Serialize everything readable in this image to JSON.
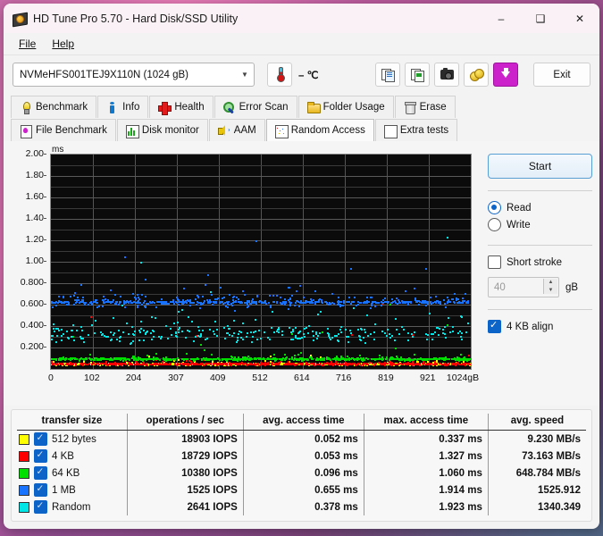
{
  "window": {
    "title": "HD Tune Pro 5.70 - Hard Disk/SSD Utility",
    "app_icon": "hard-disk-icon",
    "minimize": "–",
    "maximize": "❑",
    "close": "✕"
  },
  "menubar": {
    "items": [
      {
        "label": "File"
      },
      {
        "label": "Help"
      }
    ]
  },
  "toolbar": {
    "drive": "NVMeHFS001TEJ9X110N (1024 gB)",
    "dropdown_icon": "chevron-down-icon",
    "temperature": "– ℃",
    "thermometer_icon": "thermometer-icon",
    "buttons": [
      {
        "name": "copy-text-button",
        "icon": "copy-document-icon"
      },
      {
        "name": "copy-image-button",
        "icon": "copy-image-icon"
      },
      {
        "name": "screenshot-button",
        "icon": "camera-icon"
      },
      {
        "name": "donate-button",
        "icon": "coins-icon"
      },
      {
        "name": "download-button",
        "icon": "download-arrow-icon"
      }
    ],
    "exit": "Exit"
  },
  "tabs": {
    "row1": [
      {
        "label": "Benchmark",
        "icon": "lightbulb-icon",
        "active": false
      },
      {
        "label": "Info",
        "icon": "info-icon",
        "active": false
      },
      {
        "label": "Health",
        "icon": "red-cross-icon",
        "active": false
      },
      {
        "label": "Error Scan",
        "icon": "magnifier-icon",
        "active": false
      },
      {
        "label": "Folder Usage",
        "icon": "folder-icon",
        "active": false
      },
      {
        "label": "Erase",
        "icon": "trash-icon",
        "active": false
      }
    ],
    "row2": [
      {
        "label": "File Benchmark",
        "icon": "file-benchmark-icon",
        "active": false
      },
      {
        "label": "Disk monitor",
        "icon": "bar-chart-icon",
        "active": false
      },
      {
        "label": "AAM",
        "icon": "speaker-icon",
        "active": false
      },
      {
        "label": "Random Access",
        "icon": "scatter-plot-icon",
        "active": true
      },
      {
        "label": "Extra tests",
        "icon": "extra-tests-icon",
        "active": false
      }
    ]
  },
  "panel": {
    "start_button": "Start",
    "mode_read": "Read",
    "mode_write": "Write",
    "mode_selected": "Read",
    "short_stroke_label": "Short stroke",
    "short_stroke_checked": false,
    "short_stroke_value": "40",
    "short_stroke_unit": "gB",
    "align_label": "4 KB align",
    "align_checked": true,
    "spinner_up_icon": "spinner-up-icon",
    "spinner_down_icon": "spinner-down-icon"
  },
  "chart_data": {
    "type": "scatter",
    "title": "",
    "xlabel": "",
    "ylabel": "ms",
    "yunit": "ms",
    "xunit": "gB",
    "xlim": [
      0,
      1024
    ],
    "ylim": [
      0,
      2.0
    ],
    "grid": true,
    "background": "#0b0b0b",
    "xticks": [
      0,
      102,
      204,
      307,
      409,
      512,
      614,
      716,
      819,
      921,
      1024
    ],
    "xticklabels": [
      "0",
      "102",
      "204",
      "307",
      "409",
      "512",
      "614",
      "716",
      "819",
      "921",
      "1024gB"
    ],
    "yticks": [
      0.2,
      0.4,
      0.6,
      0.8,
      1.0,
      1.2,
      1.4,
      1.6,
      1.8,
      2.0
    ],
    "yticklabels": [
      "0.200",
      "0.400",
      "0.600",
      "0.800",
      "1.00",
      "1.20",
      "1.40",
      "1.60",
      "1.80",
      "2.00"
    ],
    "legend_position": "bottom-table",
    "series": [
      {
        "name": "512 bytes",
        "color": "#ffff00",
        "mean_ms": 0.052,
        "max_ms": 0.337,
        "band_center": 0.052,
        "band_spread": 0.03,
        "density": 260
      },
      {
        "name": "4 KB",
        "color": "#ff0000",
        "mean_ms": 0.053,
        "max_ms": 1.327,
        "band_center": 0.053,
        "band_spread": 0.032,
        "density": 300
      },
      {
        "name": "64 KB",
        "color": "#00e000",
        "mean_ms": 0.096,
        "max_ms": 1.06,
        "band_center": 0.1,
        "band_spread": 0.05,
        "density": 280
      },
      {
        "name": "1 MB",
        "color": "#1874ff",
        "mean_ms": 0.655,
        "max_ms": 1.914,
        "band_center": 0.63,
        "band_spread": 0.17,
        "density": 300
      },
      {
        "name": "Random",
        "color": "#00e5e5",
        "mean_ms": 0.378,
        "max_ms": 1.923,
        "band_center": 0.33,
        "band_spread": 0.23,
        "density": 290
      }
    ]
  },
  "results": {
    "columns": [
      "transfer size",
      "operations / sec",
      "avg. access time",
      "max. access time",
      "avg. speed"
    ],
    "rows": [
      {
        "color": "#ffff00",
        "checked": true,
        "size": "512 bytes",
        "ops": "18903 IOPS",
        "avg_access": "0.052 ms",
        "max_access": "0.337 ms",
        "avg_speed": "9.230 MB/s"
      },
      {
        "color": "#ff0000",
        "checked": true,
        "size": "4 KB",
        "ops": "18729 IOPS",
        "avg_access": "0.053 ms",
        "max_access": "1.327 ms",
        "avg_speed": "73.163 MB/s"
      },
      {
        "color": "#00e000",
        "checked": true,
        "size": "64 KB",
        "ops": "10380 IOPS",
        "avg_access": "0.096 ms",
        "max_access": "1.060 ms",
        "avg_speed": "648.784 MB/s"
      },
      {
        "color": "#1874ff",
        "checked": true,
        "size": "1 MB",
        "ops": "1525 IOPS",
        "avg_access": "0.655 ms",
        "max_access": "1.914 ms",
        "avg_speed": "1525.912"
      },
      {
        "color": "#00e5e5",
        "checked": true,
        "size": "Random",
        "ops": "2641 IOPS",
        "avg_access": "0.378 ms",
        "max_access": "1.923 ms",
        "avg_speed": "1340.349"
      }
    ]
  }
}
